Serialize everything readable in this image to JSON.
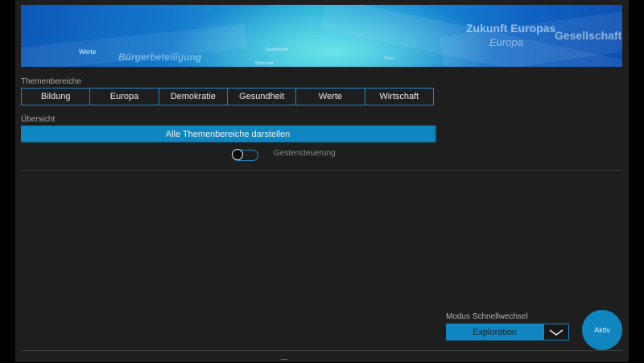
{
  "banner": {
    "words": {
      "zukunft": "Zukunft Europas",
      "europa": "Europa",
      "gesellschaft": "Gesellschaft",
      "werte": "Werte",
      "buergerbeteiligung": "Bürgerbeteiligung",
      "gesellschaft_small": "Gesellschaft",
      "wirtschaft_small": "Wirtschaft",
      "werte_small": "Werte"
    }
  },
  "themen": {
    "label": "Themenbereiche",
    "items": [
      "Bildung",
      "Europa",
      "Demokratie",
      "Gesundheit",
      "Werte",
      "Wirtschaft"
    ]
  },
  "uebersicht": {
    "label": "Übersicht",
    "button": "Alle Themenbereiche darstellen"
  },
  "gestensteuerung": {
    "label": "Gestensteuerung",
    "enabled": false
  },
  "modus": {
    "label": "Modus Schnellwechsel",
    "value": "Exploration"
  },
  "fab": {
    "label": "Aktiv"
  },
  "colors": {
    "accent": "#0f86bf",
    "border": "#1a87c4",
    "background": "#1e1e1e"
  }
}
